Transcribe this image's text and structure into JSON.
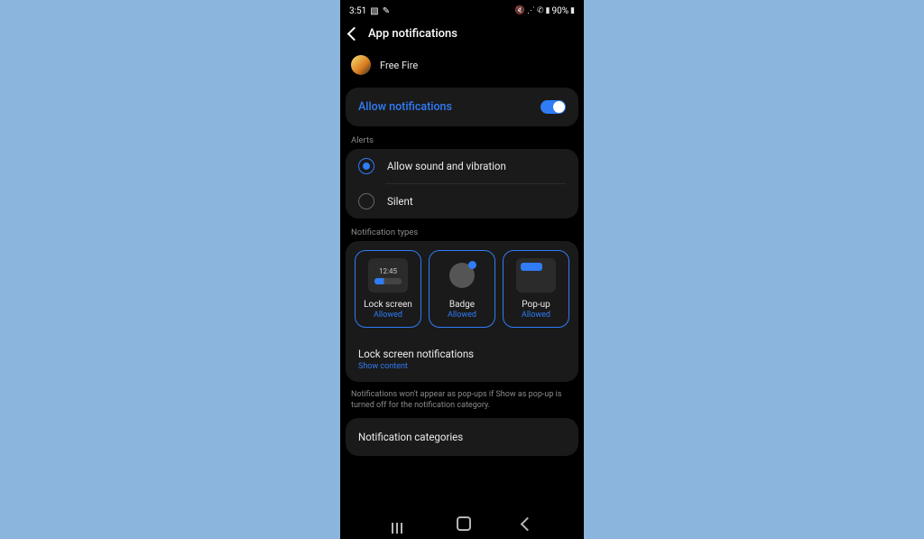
{
  "status": {
    "time": "3:51",
    "battery": "90%"
  },
  "header": {
    "title": "App notifications"
  },
  "app": {
    "name": "Free Fire"
  },
  "allow": {
    "label": "Allow notifications",
    "on": true
  },
  "sections": {
    "alerts_label": "Alerts",
    "types_label": "Notification types"
  },
  "alerts": {
    "opt1": "Allow sound and vibration",
    "opt2": "Silent",
    "selected": 0
  },
  "types": {
    "lock": {
      "name": "Lock screen",
      "status": "Allowed",
      "preview_time": "12:45"
    },
    "badge": {
      "name": "Badge",
      "status": "Allowed"
    },
    "popup": {
      "name": "Pop-up",
      "status": "Allowed"
    }
  },
  "lock_notif": {
    "title": "Lock screen notifications",
    "sub": "Show content"
  },
  "note": "Notifications won't appear as pop-ups if Show as pop-up is turned off for the notification category.",
  "categories": {
    "label": "Notification categories"
  }
}
